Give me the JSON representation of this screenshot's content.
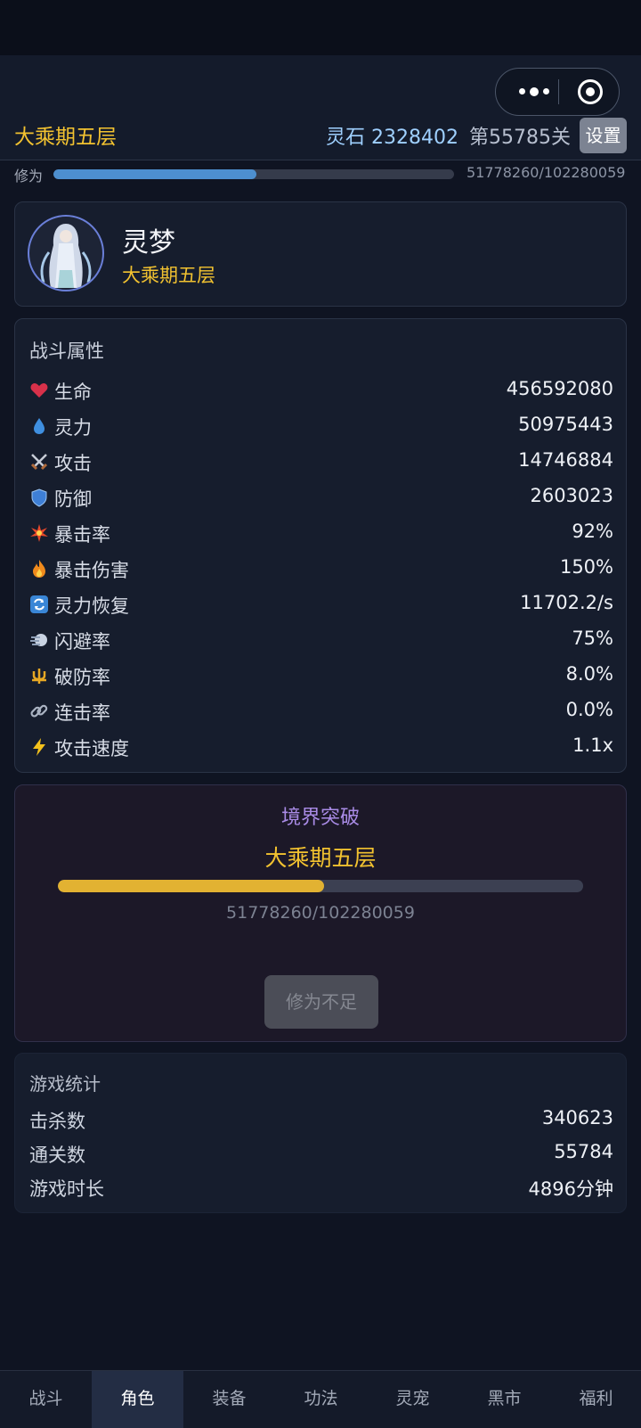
{
  "header": {
    "realm": "大乘期五层",
    "spirit_stones": "灵石 2328402",
    "stage": "第55785关",
    "settings_label": "设置"
  },
  "cultivation": {
    "label": "修为",
    "value_text": "51778260/102280059",
    "progress": 0.506
  },
  "profile": {
    "name": "灵梦",
    "realm": "大乘期五层"
  },
  "combat_stats": {
    "title": "战斗属性",
    "items": [
      {
        "icon": "heart-icon",
        "label": "生命",
        "value": "456592080"
      },
      {
        "icon": "droplet-icon",
        "label": "灵力",
        "value": "50975443"
      },
      {
        "icon": "crossed-swords-icon",
        "label": "攻击",
        "value": "14746884"
      },
      {
        "icon": "shield-icon",
        "label": "防御",
        "value": "2603023"
      },
      {
        "icon": "burst-icon",
        "label": "暴击率",
        "value": "92%"
      },
      {
        "icon": "fire-icon",
        "label": "暴击伤害",
        "value": "150%"
      },
      {
        "icon": "refresh-icon",
        "label": "灵力恢复",
        "value": "11702.2/s"
      },
      {
        "icon": "wind-icon",
        "label": "闪避率",
        "value": "75%"
      },
      {
        "icon": "trident-icon",
        "label": "破防率",
        "value": "8.0%"
      },
      {
        "icon": "link-icon",
        "label": "连击率",
        "value": "0.0%"
      },
      {
        "icon": "lightning-icon",
        "label": "攻击速度",
        "value": "1.1x"
      }
    ]
  },
  "breakthrough": {
    "title": "境界突破",
    "realm": "大乘期五层",
    "value_text": "51778260/102280059",
    "progress": 0.506,
    "button_label": "修为不足"
  },
  "game_stats": {
    "title": "游戏统计",
    "items": [
      {
        "label": "击杀数",
        "value": "340623"
      },
      {
        "label": "通关数",
        "value": "55784"
      },
      {
        "label": "游戏时长",
        "value": "4896分钟"
      }
    ]
  },
  "tabs": [
    {
      "label": "战斗",
      "active": false
    },
    {
      "label": "角色",
      "active": true
    },
    {
      "label": "装备",
      "active": false
    },
    {
      "label": "功法",
      "active": false
    },
    {
      "label": "灵宠",
      "active": false
    },
    {
      "label": "黑市",
      "active": false
    },
    {
      "label": "福利",
      "active": false
    }
  ],
  "colors": {
    "accent_gold": "#f2c230",
    "cultivation_bar": "#4d8fcf",
    "breakthrough_bar": "#e2b232",
    "breakthrough_title": "#a98be6"
  }
}
